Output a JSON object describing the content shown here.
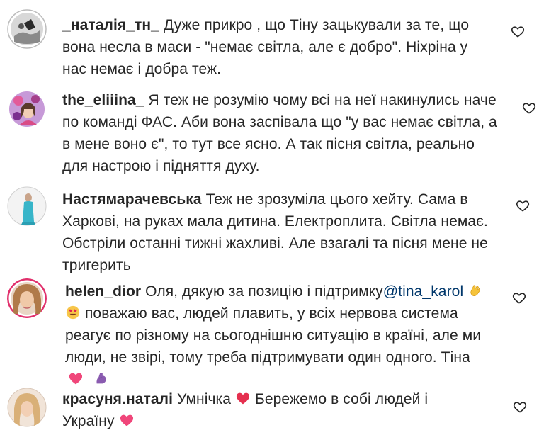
{
  "comments": [
    {
      "username": "_наталія_тн_",
      "text": "Дуже прикро , що Тіну зацькували за те, що вона несла в маси - \"немає світла, але є добро\". Ніхріна у нас немає і добра теж."
    },
    {
      "username": "the_eliiina_",
      "text": "Я теж не розумію чому всі на неї накинулись наче по команді ФАС. Аби вона заспівала що \"у вас немає світла, а в мене воно є\", то тут все ясно. А так пісня світла, реально для настрою і підняття духу."
    },
    {
      "username": "Настямарачевська",
      "text": "Теж не зрозуміла цього хейту. Сама в Харкові, на руках мала дитина. Електроплита. Світла немає. Обстріли останні тижні жахливі. Але взагалі та пісня мене не тригерить"
    },
    {
      "username": "helen_dior",
      "text_before_mention": "Оля, дякую за позицію і підтримку",
      "mention": "@tina_karol",
      "text_line2": "поважаю вас, людей плавить, у всіх нервова система",
      "text_line3": "реагує по різному на сьогоднішню ситуацію в країні, але ми",
      "text_line4": "люди, не звірі, тому треба підтримувати один одного. Тіна"
    },
    {
      "username": "красуня.наталі",
      "text_part1": "Умнічка",
      "text_part2": "Бережемо в собі людей і",
      "text_line2": "Україну"
    }
  ],
  "icons": {
    "like": "heart-outline-icon",
    "clap": "clapping-hands-emoji",
    "heart_eyes": "smiling-face-with-heart-eyes-emoji",
    "pink_heart": "pink-heart-emoji",
    "flexed_biceps": "flexed-biceps-emoji",
    "red_heart": "red-heart-emoji"
  },
  "colors": {
    "text": "#262626",
    "mention": "#00376b"
  }
}
